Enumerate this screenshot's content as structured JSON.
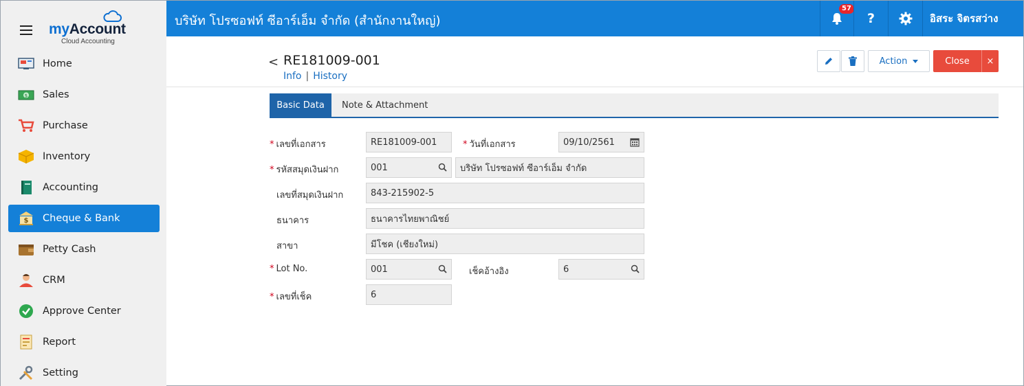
{
  "sidebar": {
    "brand_my": "my",
    "brand_account": "Account",
    "brand_sub": "Cloud Accounting",
    "items": [
      {
        "label": "Home",
        "icon": "home-icon"
      },
      {
        "label": "Sales",
        "icon": "sales-icon"
      },
      {
        "label": "Purchase",
        "icon": "cart-icon"
      },
      {
        "label": "Inventory",
        "icon": "box-icon"
      },
      {
        "label": "Accounting",
        "icon": "book-icon"
      },
      {
        "label": "Cheque & Bank",
        "icon": "bank-icon",
        "active": true
      },
      {
        "label": "Petty Cash",
        "icon": "wallet-icon"
      },
      {
        "label": "CRM",
        "icon": "person-icon"
      },
      {
        "label": "Approve Center",
        "icon": "check-icon"
      },
      {
        "label": "Report",
        "icon": "report-icon"
      },
      {
        "label": "Setting",
        "icon": "tools-icon"
      }
    ]
  },
  "topbar": {
    "company": "บริษัท โปรซอฟท์ ซีอาร์เอ็ม จำกัด (สำนักงานใหญ่)",
    "notification_count": "57",
    "help": "?",
    "username": "อิสระ จิตรสว่าง",
    "color": "#1480d8"
  },
  "doc": {
    "back": "<",
    "title": "RE181009-001",
    "link_info": "Info",
    "link_sep": "|",
    "link_history": "History",
    "action_label": "Action",
    "close_label": "Close",
    "close_x": "×"
  },
  "tabs": {
    "basic": "Basic Data",
    "note": "Note & Attachment"
  },
  "form": {
    "doc_no_label": "เลขที่เอกสาร",
    "doc_no_value": "RE181009-001",
    "doc_date_label": "วันที่เอกสาร",
    "doc_date_value": "09/10/2561",
    "bank_code_label": "รหัสสมุดเงินฝาก",
    "bank_code_value": "001",
    "bank_code_name": "บริษัท โปรซอฟท์ ซีอาร์เอ็ม จำกัด",
    "account_no_label": "เลขที่สมุดเงินฝาก",
    "account_no_value": "843-215902-5",
    "bank_label": "ธนาคาร",
    "bank_value": "ธนาคารไทยพาณิชย์",
    "branch_label": "สาขา",
    "branch_value": "มีโชค (เชียงใหม่)",
    "lot_label": "Lot No.",
    "lot_value": "001",
    "cheque_ref_label": "เช็คอ้างอิง",
    "cheque_ref_value": "6",
    "cheque_no_label": "เลขที่เช็ค",
    "cheque_no_value": "6",
    "required_mark": "*"
  }
}
